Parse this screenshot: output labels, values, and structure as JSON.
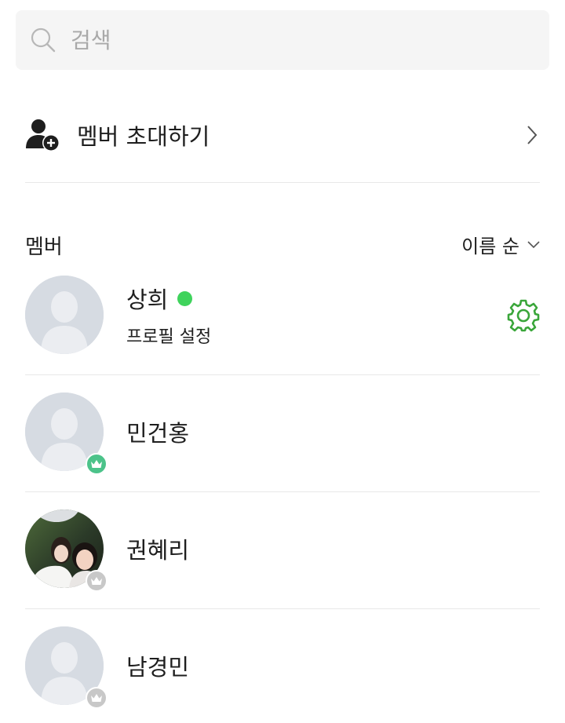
{
  "search": {
    "placeholder": "검색",
    "value": ""
  },
  "invite": {
    "label": "멤버 초대하기"
  },
  "section": {
    "title": "멤버",
    "sort_label": "이름 순"
  },
  "members": [
    {
      "name": "상희",
      "subtitle": "프로필 설정",
      "online": true,
      "badge": "none",
      "photo": "default",
      "action_icon": "gear-icon"
    },
    {
      "name": "민건홍",
      "badge": "crown-green",
      "photo": "default"
    },
    {
      "name": "권혜리",
      "badge": "crown-gray",
      "photo": "photo"
    },
    {
      "name": "남경민",
      "badge": "crown-gray",
      "photo": "default"
    }
  ],
  "colors": {
    "accent": "#3fd35c",
    "gear": "#3aa63a",
    "crown_leader": "#4cc38a",
    "crown_member": "#c8c8c8",
    "placeholder_avatar": "#d6dbe2"
  }
}
